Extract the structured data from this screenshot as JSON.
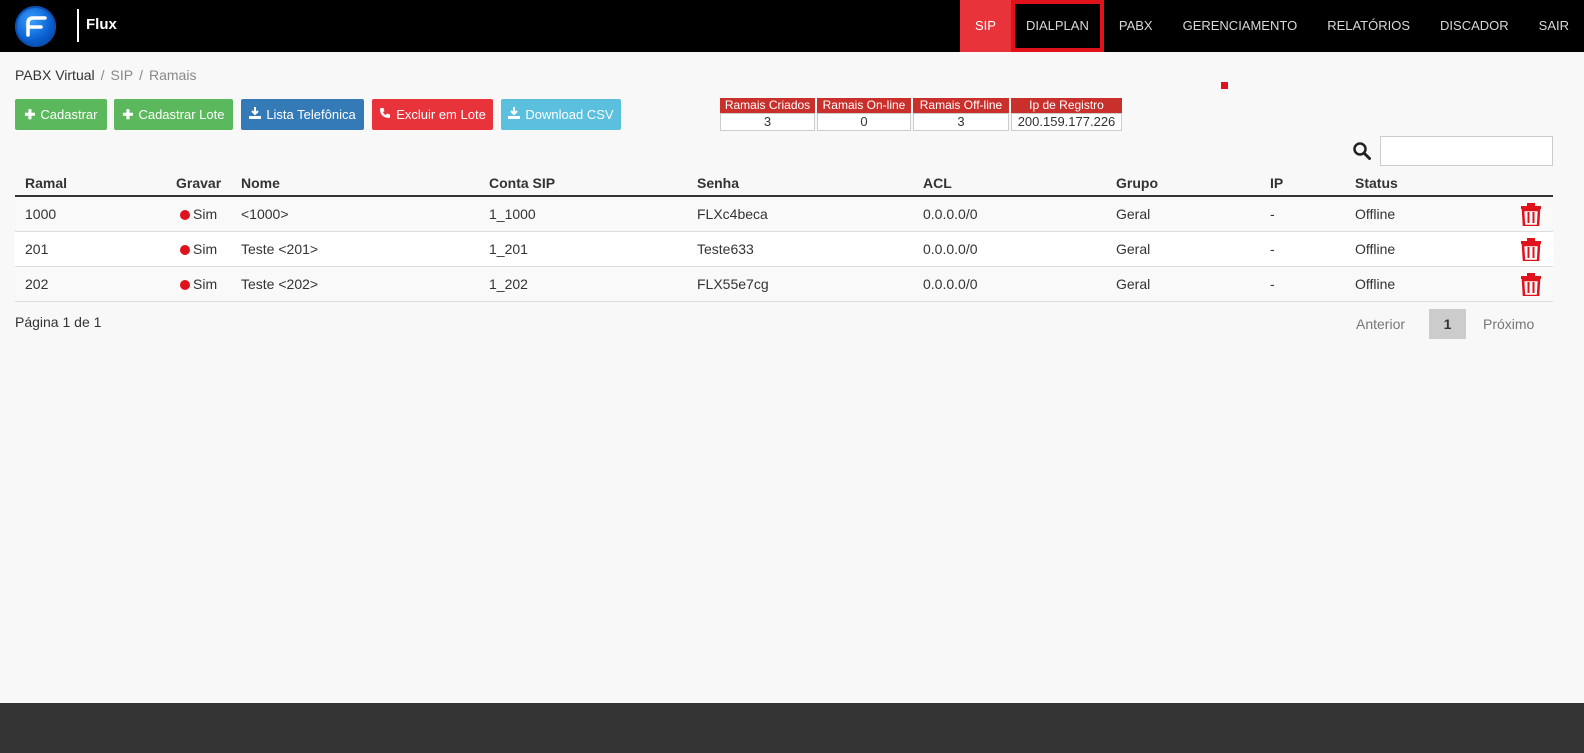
{
  "header": {
    "brand": "Flux",
    "nav": [
      {
        "label": "SIP"
      },
      {
        "label": "DIALPLAN"
      },
      {
        "label": "PABX"
      },
      {
        "label": "GERENCIAMENTO"
      },
      {
        "label": "RELATÓRIOS"
      },
      {
        "label": "DISCADOR"
      },
      {
        "label": "SAIR"
      }
    ]
  },
  "breadcrumb": {
    "items": [
      "PABX Virtual",
      "SIP",
      "Ramais"
    ],
    "separator": "/"
  },
  "toolbar": {
    "cadastrar": "Cadastrar",
    "cadastrar_lote": "Cadastrar Lote",
    "lista_telefonica": "Lista Telefônica",
    "excluir_lote": "Excluir em Lote",
    "download_csv": "Download CSV"
  },
  "stats": {
    "criados": {
      "label": "Ramais Criados",
      "value": "3"
    },
    "online": {
      "label": "Ramais On-line",
      "value": "0"
    },
    "offline": {
      "label": "Ramais Off-line",
      "value": "3"
    },
    "ip": {
      "label": "Ip de Registro",
      "value": "200.159.177.226"
    }
  },
  "search": {
    "placeholder": ""
  },
  "table": {
    "headers": {
      "ramal": "Ramal",
      "gravar": "Gravar",
      "nome": "Nome",
      "conta": "Conta SIP",
      "senha": "Senha",
      "acl": "ACL",
      "grupo": "Grupo",
      "ip": "IP",
      "status": "Status"
    },
    "rows": [
      {
        "ramal": "1000",
        "gravar": "Sim",
        "nome": "<1000>",
        "conta": "1_1000",
        "senha": "FLXc4beca",
        "acl": "0.0.0.0/0",
        "grupo": "Geral",
        "ip": "-",
        "status": "Offline"
      },
      {
        "ramal": "201",
        "gravar": "Sim",
        "nome": "Teste <201>",
        "conta": "1_201",
        "senha": "Teste633",
        "acl": "0.0.0.0/0",
        "grupo": "Geral",
        "ip": "-",
        "status": "Offline"
      },
      {
        "ramal": "202",
        "gravar": "Sim",
        "nome": "Teste <202>",
        "conta": "1_202",
        "senha": "FLX55e7cg",
        "acl": "0.0.0.0/0",
        "grupo": "Geral",
        "ip": "-",
        "status": "Offline"
      }
    ]
  },
  "pagination": {
    "info": "Página 1 de 1",
    "prev": "Anterior",
    "current": "1",
    "next": "Próximo"
  },
  "colors": {
    "accent_red": "#e8333b",
    "green": "#5cb85c",
    "blue": "#337ab7",
    "cyan": "#5bc0de"
  }
}
